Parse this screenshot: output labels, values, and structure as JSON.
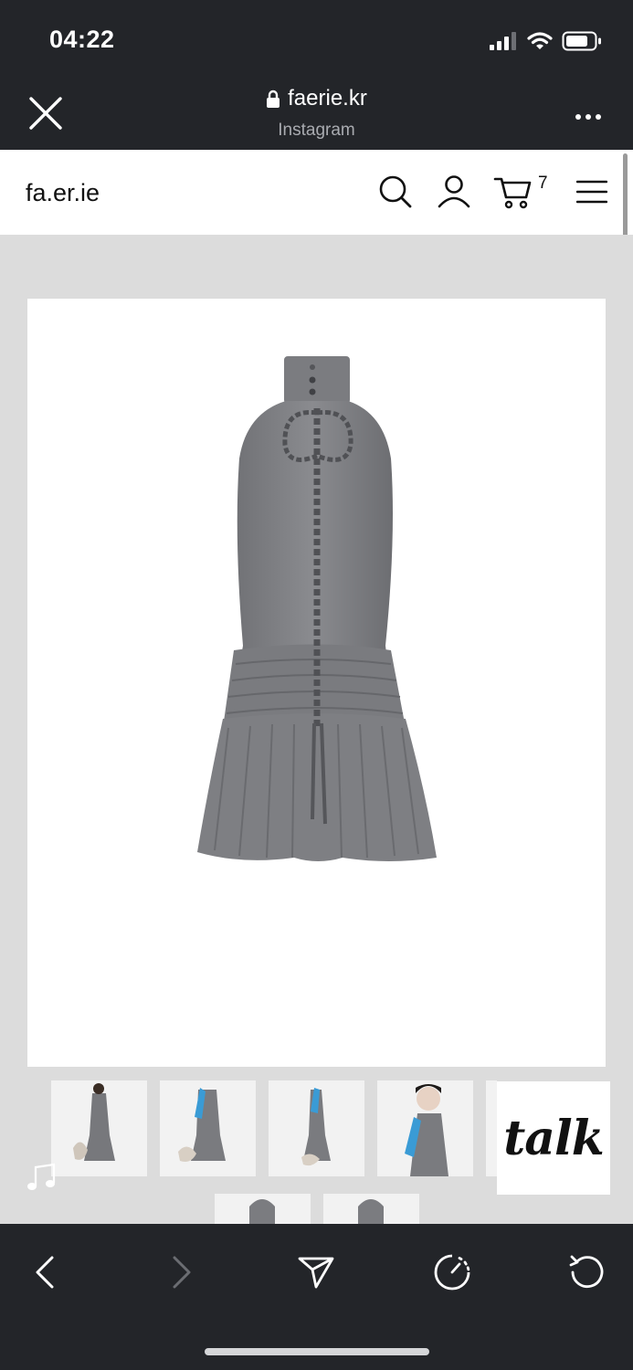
{
  "status_bar": {
    "time": "04:22"
  },
  "browser": {
    "domain": "faerie.kr",
    "source_app": "Instagram"
  },
  "site": {
    "logo": "fa.er.ie",
    "cart_count": "7"
  },
  "product": {
    "main_image": "gray-halter-dress-back-view",
    "thumbnails": 7
  },
  "chat_widget": {
    "label": "talk"
  },
  "colors": {
    "chrome": "#232529",
    "background": "#dcdcdc",
    "dress": "#7d7e82",
    "accent_blue": "#3a9bd5"
  }
}
